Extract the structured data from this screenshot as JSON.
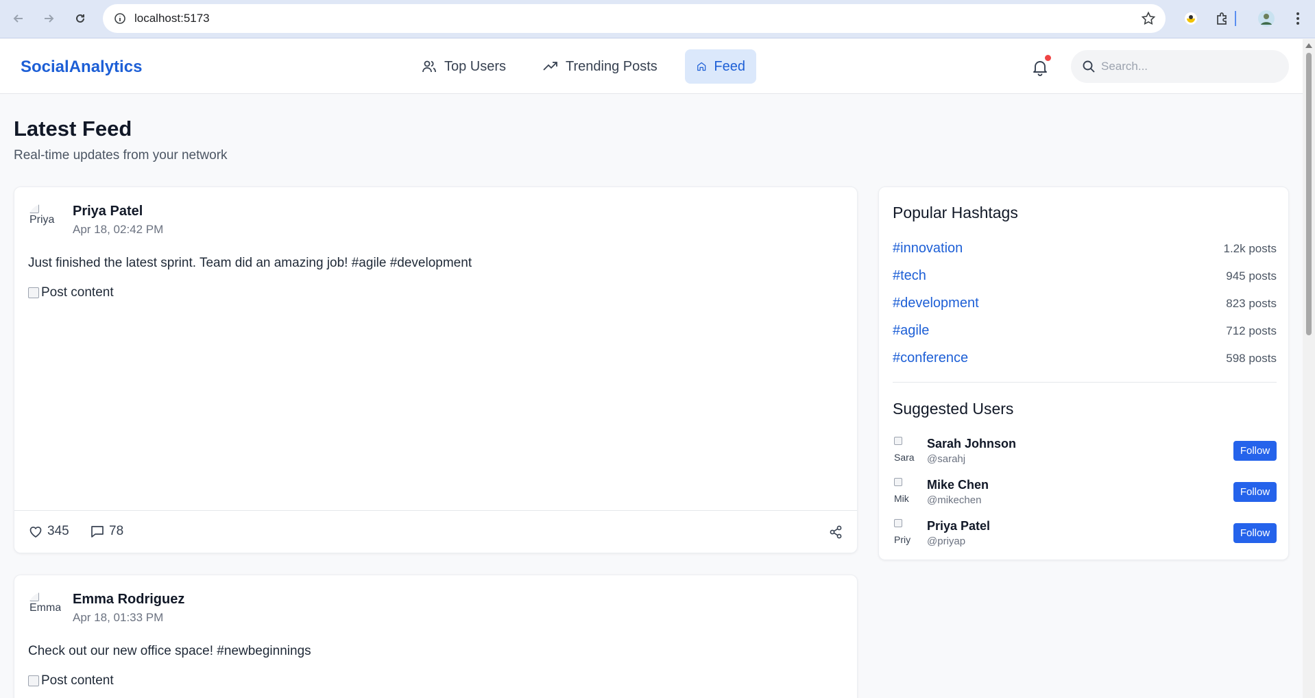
{
  "browser": {
    "url": "localhost:5173"
  },
  "header": {
    "brand": "SocialAnalytics",
    "nav": [
      {
        "label": "Top Users",
        "icon": "users-icon"
      },
      {
        "label": "Trending Posts",
        "icon": "trending-icon"
      },
      {
        "label": "Feed",
        "icon": "home-icon",
        "active": true
      }
    ],
    "search_placeholder": "Search..."
  },
  "page": {
    "title": "Latest Feed",
    "subtitle": "Real-time updates from your network"
  },
  "posts": [
    {
      "avatar_alt": "Priya",
      "author": "Priya Patel",
      "time": "Apr 18, 02:42 PM",
      "text": "Just finished the latest sprint. Team did an amazing job! #agile #development",
      "image_alt": "Post content",
      "likes": "345",
      "comments": "78"
    },
    {
      "avatar_alt": "Emma",
      "author": "Emma Rodriguez",
      "time": "Apr 18, 01:33 PM",
      "text": "Check out our new office space! #newbeginnings",
      "image_alt": "Post content"
    }
  ],
  "sidebar": {
    "hashtags_title": "Popular Hashtags",
    "hashtags": [
      {
        "tag": "#innovation",
        "count": "1.2k posts"
      },
      {
        "tag": "#tech",
        "count": "945 posts"
      },
      {
        "tag": "#development",
        "count": "823 posts"
      },
      {
        "tag": "#agile",
        "count": "712 posts"
      },
      {
        "tag": "#conference",
        "count": "598 posts"
      }
    ],
    "suggested_title": "Suggested Users",
    "suggested": [
      {
        "avatar_alt": "Sara",
        "name": "Sarah Johnson",
        "handle": "@sarahj",
        "button": "Follow"
      },
      {
        "avatar_alt": "Mik",
        "name": "Mike Chen",
        "handle": "@mikechen",
        "button": "Follow"
      },
      {
        "avatar_alt": "Priy",
        "name": "Priya Patel",
        "handle": "@priyap",
        "button": "Follow"
      }
    ]
  },
  "colors": {
    "brand": "#1d5fd6",
    "follow_button": "#2563eb",
    "notification_dot": "#ef4444"
  }
}
